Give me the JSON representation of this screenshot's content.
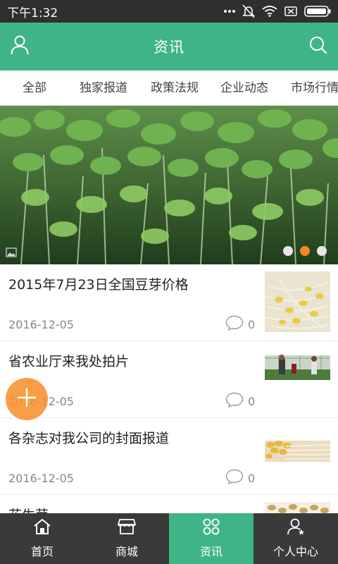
{
  "status_bar": {
    "time": "下午1:32",
    "icons": [
      "ellipsis-icon",
      "silent-icon",
      "wifi-icon",
      "sim-icon",
      "battery-icon"
    ]
  },
  "header": {
    "title": "资讯",
    "left_icon": "user-icon",
    "right_icon": "search-icon"
  },
  "tabs": [
    "全部",
    "独家报道",
    "政策法规",
    "企业动态",
    "市场行情"
  ],
  "banner": {
    "slide_count": 3,
    "active_slide": 2
  },
  "news": [
    {
      "title": "2015年7月23日全国豆芽价格",
      "date": "2016-12-05",
      "comments": "0",
      "thumb": "bean-sprouts"
    },
    {
      "title": "省农业厅来我处拍片",
      "date": "2016-12-05",
      "comments": "0",
      "thumb": "greenhouse"
    },
    {
      "title": "各杂志对我公司的封面报道",
      "date": "2016-12-05",
      "comments": "0",
      "thumb": "sprout-bundle"
    },
    {
      "title": "花生芽",
      "date": "",
      "comments": "",
      "thumb": "peanut-sprouts"
    }
  ],
  "fab": {
    "icon": "plus-icon"
  },
  "bottom_nav": [
    {
      "label": "首页",
      "icon": "home-icon"
    },
    {
      "label": "商城",
      "icon": "store-icon"
    },
    {
      "label": "资讯",
      "icon": "grid-icon",
      "active": true
    },
    {
      "label": "个人中心",
      "icon": "profile-icon"
    }
  ],
  "colors": {
    "primary": "#3fb486",
    "accent": "#f28a1e",
    "nav_bg": "#3a3a3a",
    "status_bg": "#2f2f2f"
  }
}
